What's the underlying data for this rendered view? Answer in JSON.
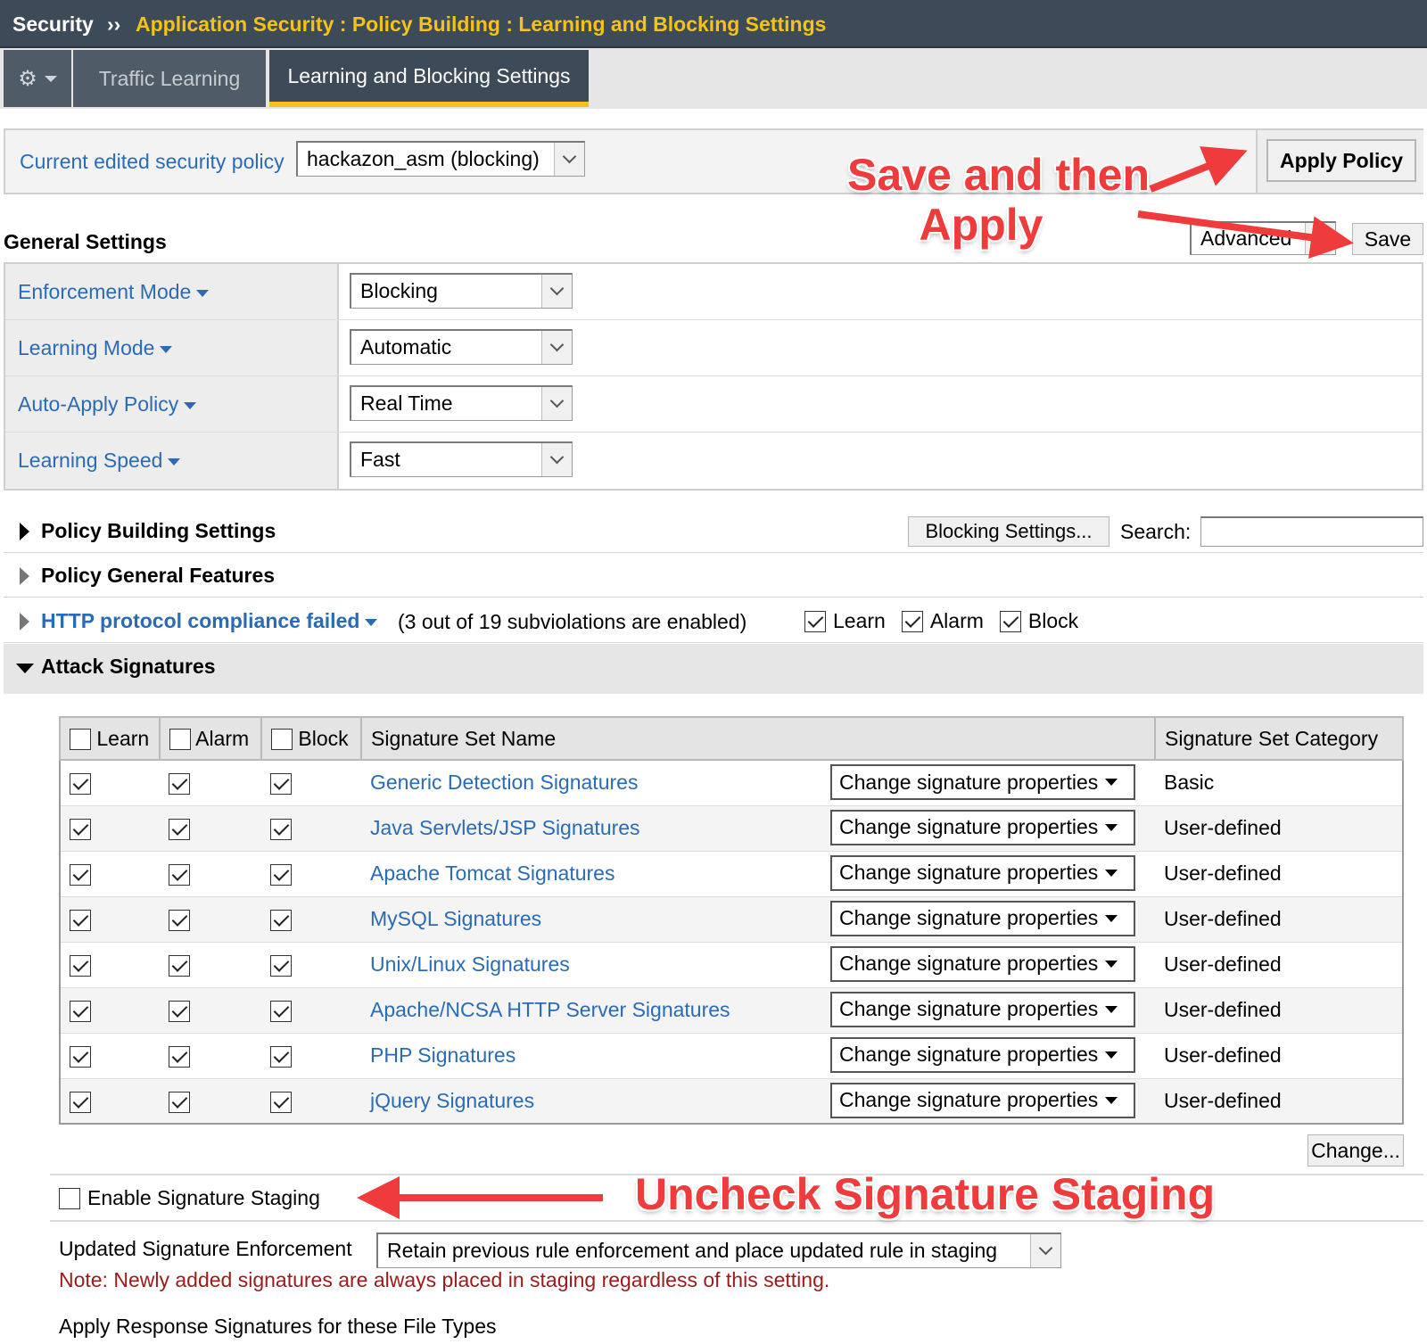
{
  "breadcrumb": {
    "root": "Security",
    "separator": "››",
    "path": "Application Security : Policy Building : Learning and Blocking Settings"
  },
  "tabs": {
    "gear_icon": "gear-icon",
    "traffic": "Traffic Learning",
    "learning": "Learning and Blocking Settings"
  },
  "policy": {
    "label": "Current edited security policy",
    "value": "hackazon_asm (blocking)",
    "apply_button": "Apply Policy"
  },
  "general": {
    "title": "General Settings",
    "view_select": "Advanced",
    "save_button": "Save",
    "rows": [
      {
        "label": "Enforcement Mode",
        "value": "Blocking"
      },
      {
        "label": "Learning Mode",
        "value": "Automatic"
      },
      {
        "label": "Auto-Apply Policy",
        "value": "Real Time"
      },
      {
        "label": "Learning Speed",
        "value": "Fast"
      }
    ]
  },
  "sections": {
    "policy_building": "Policy Building Settings",
    "blocking_button": "Blocking Settings...",
    "search_label": "Search:",
    "search_value": "",
    "general_features": "Policy General Features",
    "http_link": "HTTP protocol compliance failed",
    "http_note": "(3 out of 19 subviolations are enabled)",
    "http_learn": "Learn",
    "http_alarm": "Alarm",
    "http_block": "Block",
    "attack": "Attack Signatures"
  },
  "signatures": {
    "headers": {
      "learn": "Learn",
      "alarm": "Alarm",
      "block": "Block",
      "name": "Signature Set Name",
      "category": "Signature Set Category"
    },
    "change_props": "Change signature properties",
    "rows": [
      {
        "name": "Generic Detection Signatures",
        "category": "Basic"
      },
      {
        "name": "Java Servlets/JSP Signatures",
        "category": "User-defined"
      },
      {
        "name": "Apache Tomcat Signatures",
        "category": "User-defined"
      },
      {
        "name": "MySQL Signatures",
        "category": "User-defined"
      },
      {
        "name": "Unix/Linux Signatures",
        "category": "User-defined"
      },
      {
        "name": "Apache/NCSA HTTP Server Signatures",
        "category": "User-defined"
      },
      {
        "name": "PHP Signatures",
        "category": "User-defined"
      },
      {
        "name": "jQuery Signatures",
        "category": "User-defined"
      }
    ],
    "change_button": "Change...",
    "staging_label": "Enable Signature Staging",
    "enforcement_label": "Updated Signature Enforcement",
    "enforcement_value": "Retain previous rule enforcement and place updated rule in staging",
    "note": "Note: Newly added signatures are always placed in staging regardless of this setting.",
    "response_label": "Apply Response Signatures for these File Types"
  },
  "annotations": {
    "save_then_apply_line1": "Save and then",
    "save_then_apply_line2": "Apply",
    "uncheck_staging": "Uncheck Signature Staging",
    "color": "#ef3b3b"
  },
  "colors": {
    "header_bg": "#3d4a58",
    "breadcrumb_accent": "#f5c21b",
    "link": "#2b6bb5",
    "note": "#9b1b1b"
  }
}
